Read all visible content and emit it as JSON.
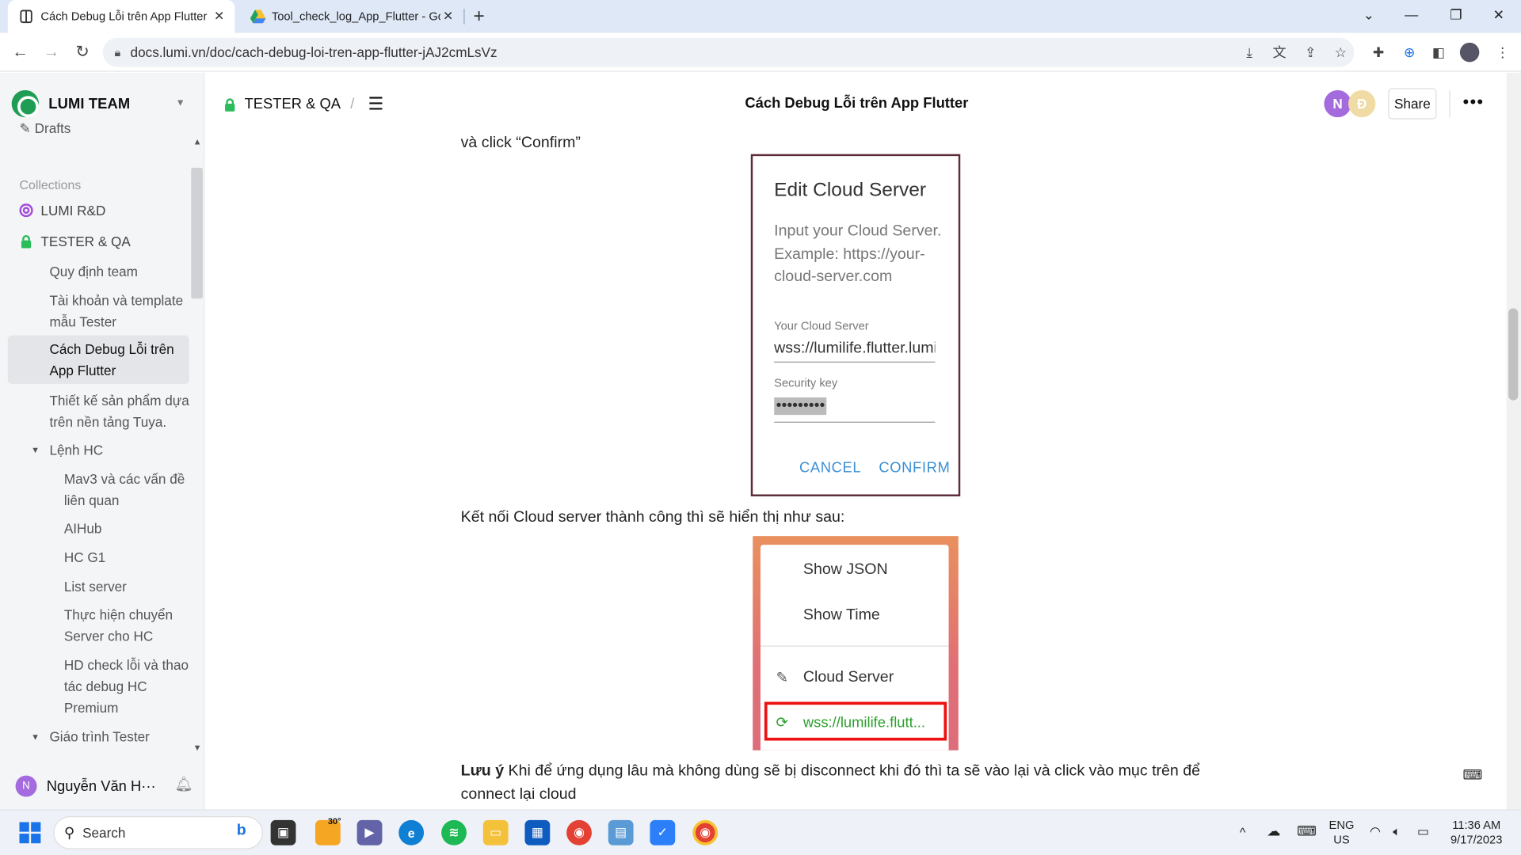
{
  "browser": {
    "tabs": [
      {
        "title": "Cách Debug Lỗi trên App Flutter",
        "active": true
      },
      {
        "title": "Tool_check_log_App_Flutter - Go",
        "active": false
      }
    ],
    "url": "docs.lumi.vn/doc/cach-debug-loi-tren-app-flutter-jAJ2cmLsVz",
    "new_tab": "+"
  },
  "sidebar": {
    "workspace": "LUMI TEAM",
    "drafts": "Drafts",
    "collections_header": "Collections",
    "collections": [
      {
        "label": "LUMI R&D",
        "icon": "target-icon",
        "color": "#a24bd8"
      },
      {
        "label": "TESTER & QA",
        "icon": "lock-icon",
        "color": "#2bbd5a"
      }
    ],
    "docs": [
      {
        "label": "Quy định team"
      },
      {
        "label": "Tài khoản và template mẫu Tester"
      },
      {
        "label": "Cách Debug Lỗi trên App Flutter",
        "selected": true
      },
      {
        "label": "Thiết kế sản phẩm dựa trên nền tảng Tuya."
      },
      {
        "label": "Lệnh HC",
        "expanded": true
      },
      {
        "label": "Mav3 và các vấn đề liên quan"
      },
      {
        "label": "AIHub"
      },
      {
        "label": "HC G1"
      },
      {
        "label": "List server"
      },
      {
        "label": "Thực hiện chuyển Server cho HC"
      },
      {
        "label": "HD check lỗi và thao tác debug HC Premium"
      },
      {
        "label": "Giáo trình Tester",
        "expanded": true
      }
    ],
    "user": {
      "initial": "N",
      "name": "Nguyễn Văn H···"
    }
  },
  "header": {
    "breadcrumb": "TESTER & QA",
    "separator": "/",
    "title": "Cách Debug Lỗi trên App Flutter",
    "avatars": [
      {
        "initial": "N",
        "color": "#a46bde"
      },
      {
        "initial": "Đ",
        "color": "#f1dba4"
      }
    ],
    "share_label": "Share"
  },
  "content": {
    "line1": "và click “Confirm”",
    "dialog": {
      "title": "Edit Cloud Server",
      "desc": "Input your Cloud Server. Example: https://your-cloud-server.com",
      "server_label": "Your Cloud Server",
      "server_value": "wss://lumilife.flutter.lumi",
      "key_label": "Security key",
      "key_value": "•••••••••",
      "cancel": "CANCEL",
      "confirm": "CONFIRM"
    },
    "line2": "Kết nối Cloud server thành công thì sẽ hiển thị như sau:",
    "menu": {
      "items": [
        "Show JSON",
        "Show Time",
        "Cloud Server"
      ],
      "connected": "wss://lumilife.flutt..."
    },
    "note_bold": "Lưu ý",
    "note_text": " Khi để ứng dụng lâu mà không dùng sẽ bị disconnect khi đó thì ta sẽ vào lại và click vào mục trên để connect lại cloud"
  },
  "taskbar": {
    "search": "Search",
    "weather": "30°",
    "lang_top": "ENG",
    "lang_bottom": "US",
    "time": "11:36 AM",
    "date": "9/17/2023"
  }
}
